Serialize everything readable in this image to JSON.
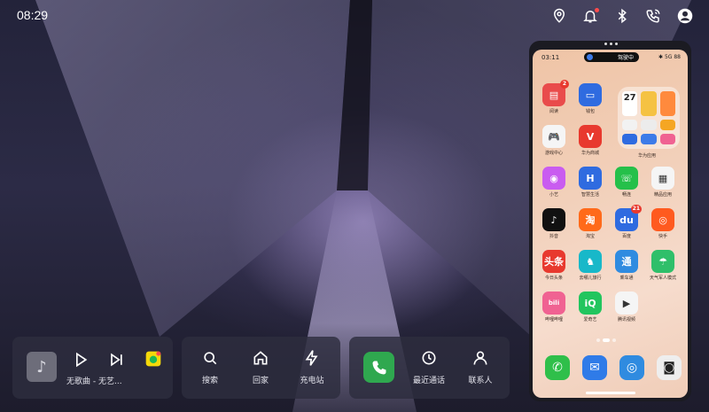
{
  "status_bar": {
    "time": "08:29",
    "icons": [
      "location-icon",
      "notification-bell-icon",
      "bluetooth-icon",
      "wireless-phone-icon",
      "user-avatar-icon"
    ],
    "alert_color": "#ff4b4b"
  },
  "media": {
    "song": "无歌曲 - 无艺...",
    "icons": [
      "music-note-icon",
      "play-icon",
      "skip-next-icon",
      "music-app-icon"
    ]
  },
  "navigation": {
    "actions": [
      {
        "label": "搜索",
        "icon": "search-icon"
      },
      {
        "label": "回家",
        "icon": "home-icon"
      },
      {
        "label": "充电站",
        "icon": "lightning-icon"
      }
    ]
  },
  "communication": {
    "phone_icon": "phone-icon",
    "phone_color": "#2fa84f",
    "actions": [
      {
        "label": "最近通话",
        "icon": "clock-icon"
      },
      {
        "label": "联系人",
        "icon": "person-icon"
      }
    ]
  },
  "phone_mirror": {
    "time": "03:11",
    "pill_text": "驾驶中",
    "status_right": "✱ 5G 88",
    "folder_label": "华为应用",
    "folder_date": "27",
    "apps": [
      {
        "label": "阅读",
        "color": "#e94b4b",
        "glyph": "▤",
        "badge": "2"
      },
      {
        "label": "钱包",
        "color": "#2f6be0",
        "glyph": "▭",
        "badge": ""
      },
      {
        "label": "游戏中心",
        "color": "#f5f5f5",
        "glyph": "🎮",
        "badge": ""
      },
      {
        "label": "华为商城",
        "color": "#e8392e",
        "glyph": "V",
        "badge": ""
      },
      {
        "label": "小艺",
        "color": "#c95cf0",
        "glyph": "◉",
        "badge": ""
      },
      {
        "label": "智慧生活",
        "color": "#2f6be0",
        "glyph": "H",
        "badge": ""
      },
      {
        "label": "畅连",
        "color": "#25c04a",
        "glyph": "☏",
        "badge": ""
      },
      {
        "label": "精品应用",
        "color": "#f5f5f5",
        "glyph": "▦",
        "badge": ""
      },
      {
        "label": "抖音",
        "color": "#111111",
        "glyph": "♪",
        "badge": ""
      },
      {
        "label": "淘宝",
        "color": "#ff6a1a",
        "glyph": "淘",
        "badge": ""
      },
      {
        "label": "百度",
        "color": "#2f6be0",
        "glyph": "du",
        "badge": "21"
      },
      {
        "label": "快手",
        "color": "#ff5a1f",
        "glyph": "◎",
        "badge": ""
      },
      {
        "label": "今日头条",
        "color": "#e8392e",
        "glyph": "头条",
        "badge": ""
      },
      {
        "label": "去哪儿旅行",
        "color": "#18b8c9",
        "glyph": "♞",
        "badge": ""
      },
      {
        "label": "乘车通",
        "color": "#2f8be0",
        "glyph": "通",
        "badge": ""
      },
      {
        "label": "天气军人模式",
        "color": "#2fbf6a",
        "glyph": "☂",
        "badge": ""
      },
      {
        "label": "哔哩哔哩",
        "color": "#f06292",
        "glyph": "bili",
        "badge": ""
      },
      {
        "label": "爱奇艺",
        "color": "#22c55e",
        "glyph": "iQ",
        "badge": ""
      },
      {
        "label": "腾讯视频",
        "color": "#f5f5f5",
        "glyph": "▶",
        "badge": ""
      }
    ],
    "dock": [
      {
        "name": "phone-app-icon",
        "color": "#2fbf4a",
        "glyph": "✆"
      },
      {
        "name": "messages-app-icon",
        "color": "#2f7be8",
        "glyph": "✉"
      },
      {
        "name": "browser-app-icon",
        "color": "#2f8be0",
        "glyph": "◎"
      },
      {
        "name": "camera-app-icon",
        "color": "#eeeeee",
        "glyph": "◙"
      }
    ]
  }
}
